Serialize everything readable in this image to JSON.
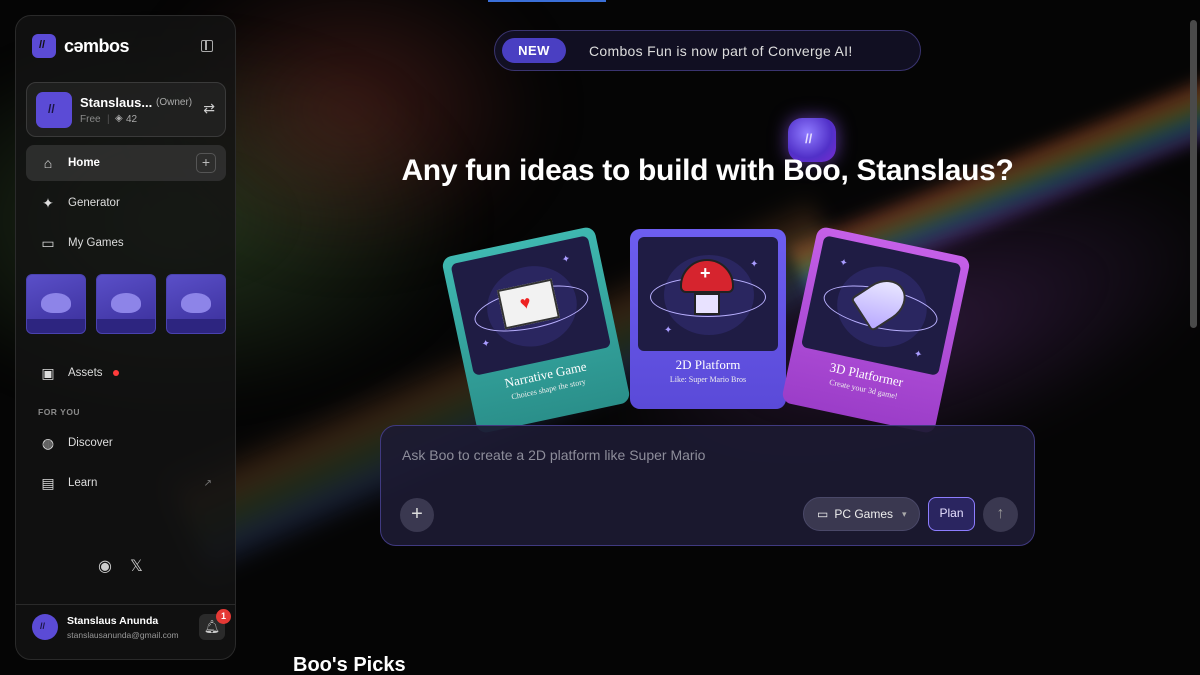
{
  "app": {
    "logo_text": "cəmbos",
    "logo_mark": "//"
  },
  "account": {
    "name": "Stanslaus...",
    "role": "(Owner)",
    "plan": "Free",
    "separator": "|",
    "points": "42",
    "avatar_mark": "//"
  },
  "sidebar": {
    "home": "Home",
    "generator": "Generator",
    "my_games": "My Games",
    "assets": "Assets",
    "section_for_you": "FOR YOU",
    "discover": "Discover",
    "learn": "Learn",
    "thumbnails": [
      "game-thumb",
      "game-thumb",
      "game-thumb"
    ]
  },
  "user": {
    "name": "Stanslaus Anunda",
    "email": "stanslausanunda@gmail.com",
    "avatar_mark": "//",
    "notification_count": "1"
  },
  "announcement": {
    "badge": "NEW",
    "message": "Combos Fun is now part of Converge AI!"
  },
  "mascot": {
    "mark": "//"
  },
  "heading": "Any fun ideas to build with Boo, Stanslaus?",
  "cards": [
    {
      "title": "Narrative Game",
      "subtitle": "Choices shape the story",
      "icon": "envelope-heart"
    },
    {
      "title": "2D Platform",
      "subtitle": "Like: Super Mario Bros",
      "icon": "mushroom"
    },
    {
      "title": "3D Platformer",
      "subtitle": "Create your 3d game!",
      "icon": "rocket"
    }
  ],
  "prompt": {
    "placeholder": "Ask Boo to create a 2D platform like Super Mario",
    "add_label": "+",
    "platform_select": "PC Games",
    "plan_button": "Plan",
    "send_icon": "↑"
  },
  "picks_heading": "Boo's Picks",
  "colors": {
    "accent": "#5b4bd6",
    "badge_red": "#e53935",
    "card_teal": "#3fb8b0",
    "card_purple": "#6d5ef0",
    "card_pink": "#c560e8"
  }
}
